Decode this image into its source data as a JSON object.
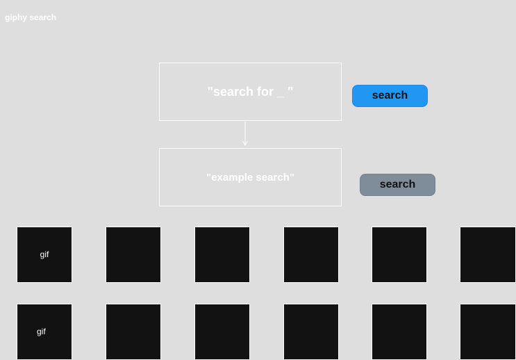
{
  "app": {
    "title": "giphy search"
  },
  "search_mockup": {
    "query_box_text": "\"search for _ \"",
    "example_box_text": "\"example search\"",
    "primary_button_label": "search",
    "secondary_button_label": "search"
  },
  "results": {
    "row1": [
      {
        "label": "gif"
      },
      {
        "label": ""
      },
      {
        "label": ""
      },
      {
        "label": ""
      },
      {
        "label": ""
      },
      {
        "label": ""
      }
    ],
    "row2": [
      {
        "label": "gif"
      },
      {
        "label": ""
      },
      {
        "label": ""
      },
      {
        "label": ""
      },
      {
        "label": ""
      },
      {
        "label": ""
      }
    ]
  },
  "colors": {
    "background": "#dedede",
    "primary_button": "#2196f3",
    "secondary_button": "#7f8c9a",
    "tile": "#121212"
  }
}
